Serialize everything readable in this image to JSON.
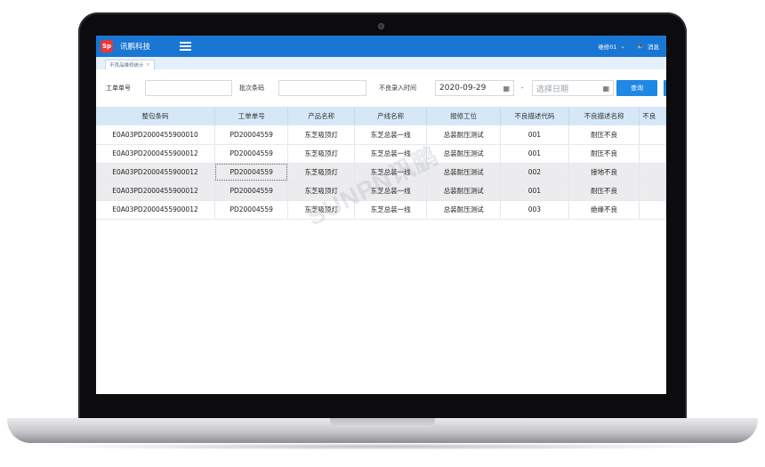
{
  "app": {
    "logo_text": "Sp",
    "brand": "讯鹏科技"
  },
  "header": {
    "user": "维修01",
    "user_caret": "⌄",
    "message": "消息"
  },
  "tabs": [
    {
      "label": "不良品维修统计"
    }
  ],
  "filters": {
    "order_label": "工单单号",
    "order_value": "",
    "batch_label": "批次条码",
    "batch_value": "",
    "time_label": "不良录入时间",
    "start_date": "2020-09-29",
    "range_sep": "-",
    "end_placeholder": "选择日期",
    "query_label": "查询"
  },
  "table": {
    "columns": [
      "整包条码",
      "工单单号",
      "产品名称",
      "产线名称",
      "报修工位",
      "不良描述代码",
      "不良描述名称",
      "不良"
    ],
    "rows": [
      [
        "E0A03PD2000455900010",
        "PD20004559",
        "东芝吸顶灯",
        "东芝总装一线",
        "总装耐压测试",
        "001",
        "耐压不良"
      ],
      [
        "E0A03PD2000455900012",
        "PD20004559",
        "东芝吸顶灯",
        "东芝总装一线",
        "总装耐压测试",
        "001",
        "耐压不良"
      ],
      [
        "E0A03PD2000455900012",
        "PD20004559",
        "东芝吸顶灯",
        "东芝总装一线",
        "总装耐压测试",
        "002",
        "接地不良"
      ],
      [
        "E0A03PD2000455900012",
        "PD20004559",
        "东芝吸顶灯",
        "东芝总装一线",
        "总装耐压测试",
        "001",
        "耐压不良"
      ],
      [
        "E0A03PD2000455900012",
        "PD20004559",
        "东芝吸顶灯",
        "东芝总装一线",
        "总装耐压测试",
        "003",
        "绝缘不良"
      ]
    ]
  },
  "watermark": "SUNPN讯鹏",
  "colors": {
    "topbar": "#1976d2",
    "header_row": "#d6e8f8",
    "query_button": "#1e88e5",
    "logo": "#e53935"
  }
}
